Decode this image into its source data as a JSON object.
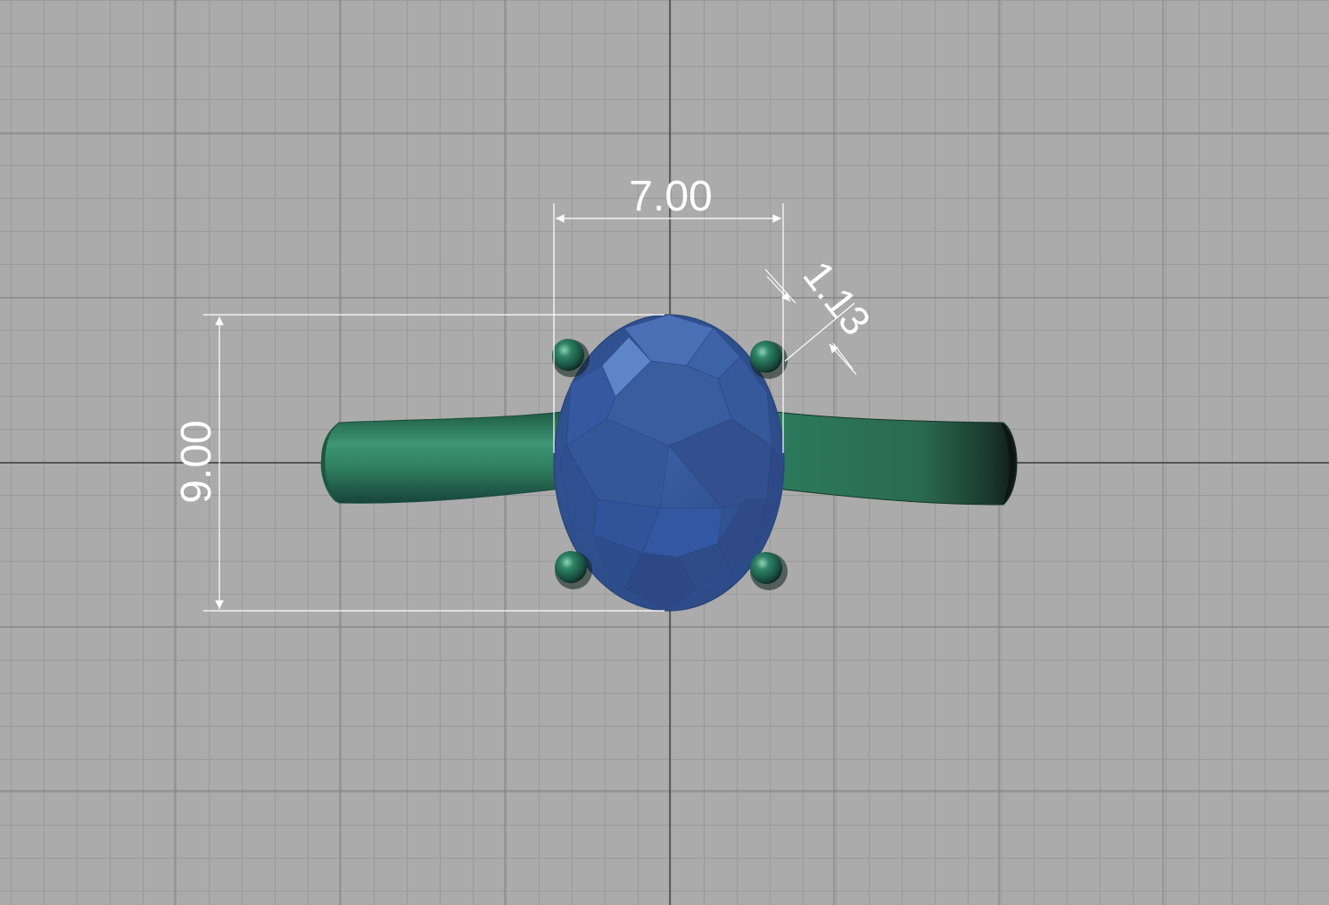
{
  "viewport": {
    "background_color": "#ababab",
    "grid_minor_color": "#9a9a9a",
    "grid_major_color": "#7b7b7b",
    "axis_color": "#3c3c3c"
  },
  "model": {
    "band_color": "#2e7a5d",
    "prong_color": "#1f6a55",
    "stone_color": "#34589a"
  },
  "dimensions": {
    "stone_width": "7.00",
    "stone_length": "9.00",
    "prong_size": "1.13",
    "color": "#ffffff"
  }
}
